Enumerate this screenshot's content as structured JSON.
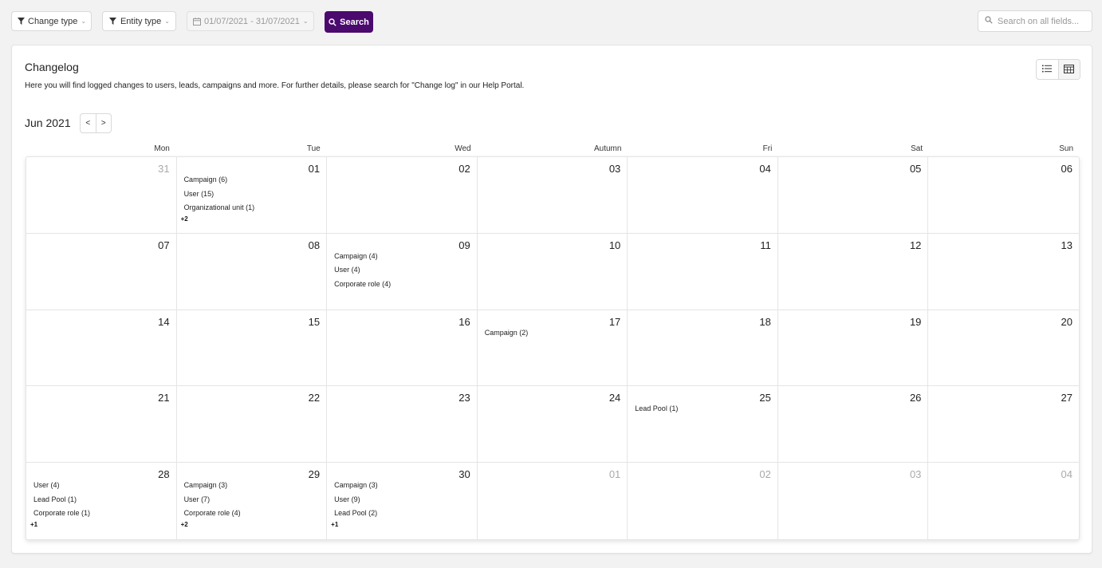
{
  "toolbar": {
    "change_type_label": "Change type",
    "entity_type_label": "Entity type",
    "date_range_label": "01/07/2021 - 31/07/2021",
    "search_button_label": "Search",
    "search_placeholder": "Search on all fields...",
    "accent_color": "#4b0a6e"
  },
  "card": {
    "title": "Changelog",
    "description": "Here you will find logged changes to users, leads, campaigns and more. For further details, please search for \"Change log\" in our Help Portal.",
    "view_toggle": {
      "options": [
        "list-icon",
        "calendar-icon"
      ],
      "active": "calendar-icon"
    }
  },
  "calendar": {
    "month_label": "Jun 2021",
    "prev_label": "<",
    "next_label": ">",
    "weekdays": [
      "Mon",
      "Tue",
      "Wed",
      "Autumn",
      "Fri",
      "Sat",
      "Sun"
    ],
    "cells": [
      {
        "day": "31",
        "other": true,
        "events": [],
        "more": ""
      },
      {
        "day": "01",
        "other": false,
        "events": [
          "Campaign (6)",
          "User (15)",
          "Organizational unit (1)"
        ],
        "more": "+2"
      },
      {
        "day": "02",
        "other": false,
        "events": [],
        "more": ""
      },
      {
        "day": "03",
        "other": false,
        "events": [],
        "more": ""
      },
      {
        "day": "04",
        "other": false,
        "events": [],
        "more": ""
      },
      {
        "day": "05",
        "other": false,
        "events": [],
        "more": ""
      },
      {
        "day": "06",
        "other": false,
        "events": [],
        "more": ""
      },
      {
        "day": "07",
        "other": false,
        "events": [],
        "more": ""
      },
      {
        "day": "08",
        "other": false,
        "events": [],
        "more": ""
      },
      {
        "day": "09",
        "other": false,
        "events": [
          "Campaign (4)",
          "User (4)",
          "Corporate role (4)"
        ],
        "more": ""
      },
      {
        "day": "10",
        "other": false,
        "events": [],
        "more": ""
      },
      {
        "day": "11",
        "other": false,
        "events": [],
        "more": ""
      },
      {
        "day": "12",
        "other": false,
        "events": [],
        "more": ""
      },
      {
        "day": "13",
        "other": false,
        "events": [],
        "more": ""
      },
      {
        "day": "14",
        "other": false,
        "events": [],
        "more": ""
      },
      {
        "day": "15",
        "other": false,
        "events": [],
        "more": ""
      },
      {
        "day": "16",
        "other": false,
        "events": [],
        "more": ""
      },
      {
        "day": "17",
        "other": false,
        "events": [
          "Campaign (2)"
        ],
        "more": ""
      },
      {
        "day": "18",
        "other": false,
        "events": [],
        "more": ""
      },
      {
        "day": "19",
        "other": false,
        "events": [],
        "more": ""
      },
      {
        "day": "20",
        "other": false,
        "events": [],
        "more": ""
      },
      {
        "day": "21",
        "other": false,
        "events": [],
        "more": ""
      },
      {
        "day": "22",
        "other": false,
        "events": [],
        "more": ""
      },
      {
        "day": "23",
        "other": false,
        "events": [],
        "more": ""
      },
      {
        "day": "24",
        "other": false,
        "events": [],
        "more": ""
      },
      {
        "day": "25",
        "other": false,
        "events": [
          "Lead Pool (1)"
        ],
        "more": ""
      },
      {
        "day": "26",
        "other": false,
        "events": [],
        "more": ""
      },
      {
        "day": "27",
        "other": false,
        "events": [],
        "more": ""
      },
      {
        "day": "28",
        "other": false,
        "events": [
          "User (4)",
          "Lead Pool (1)",
          "Corporate role (1)"
        ],
        "more": "+1"
      },
      {
        "day": "29",
        "other": false,
        "events": [
          "Campaign (3)",
          "User (7)",
          "Corporate role (4)"
        ],
        "more": "+2"
      },
      {
        "day": "30",
        "other": false,
        "events": [
          "Campaign (3)",
          "User (9)",
          "Lead Pool (2)"
        ],
        "more": "+1"
      },
      {
        "day": "01",
        "other": true,
        "events": [],
        "more": ""
      },
      {
        "day": "02",
        "other": true,
        "events": [],
        "more": ""
      },
      {
        "day": "03",
        "other": true,
        "events": [],
        "more": ""
      },
      {
        "day": "04",
        "other": true,
        "events": [],
        "more": ""
      }
    ]
  }
}
